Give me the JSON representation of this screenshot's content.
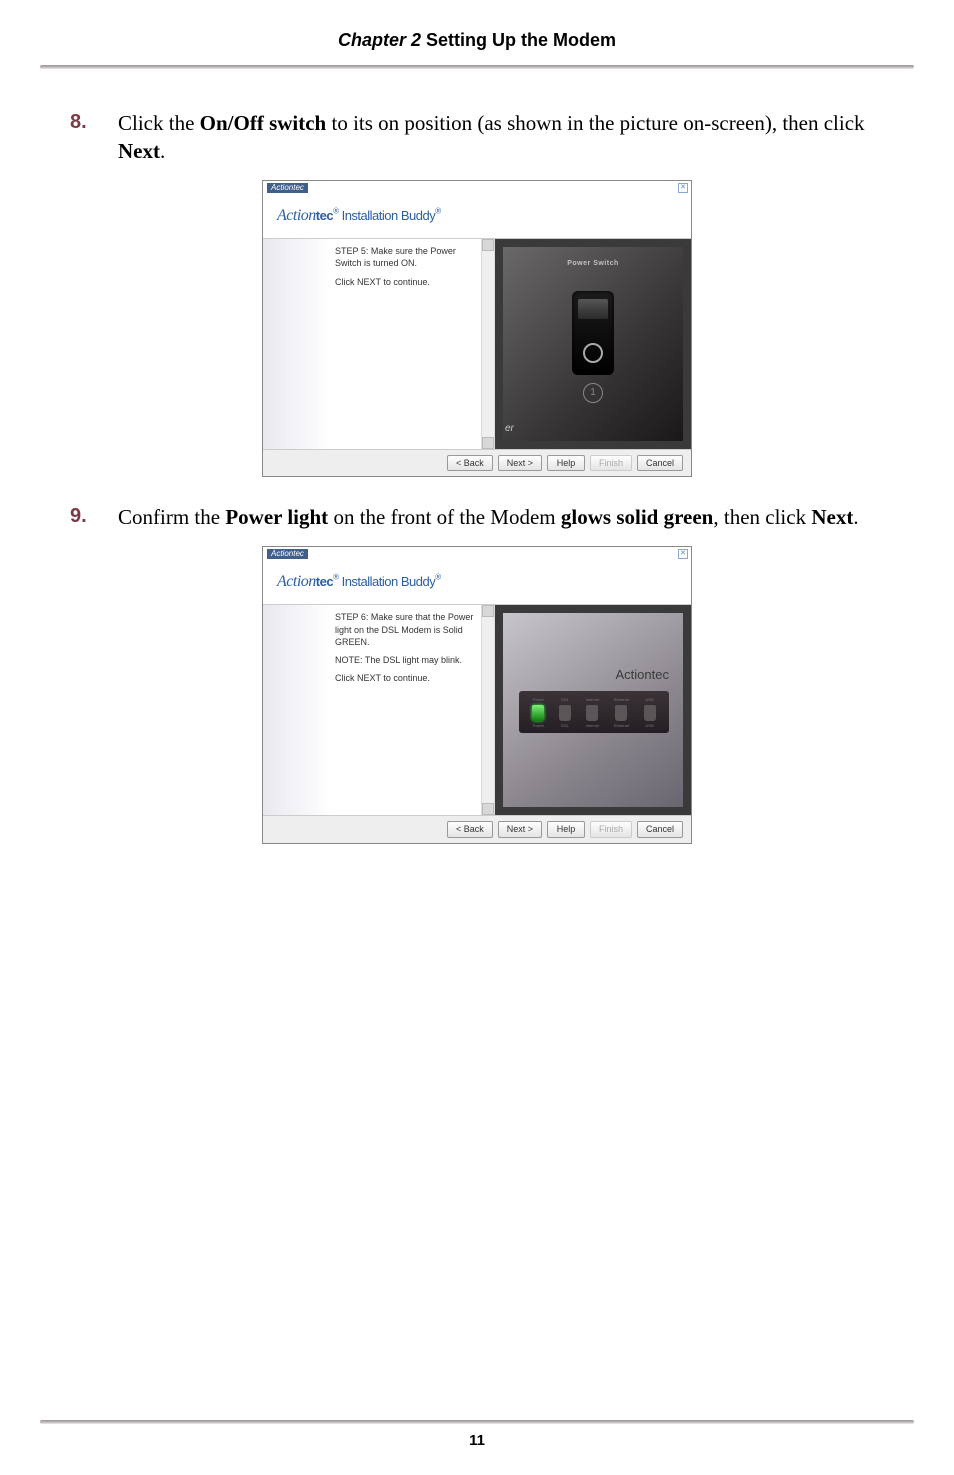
{
  "header": {
    "chapter_label": "Chapter 2",
    "chapter_title": "  Setting Up the Modem"
  },
  "steps": {
    "s8": {
      "num": "8.",
      "pre": "Click the ",
      "b1": "On/Off switch",
      "mid": " to its on position (as shown in the picture on-screen), then click ",
      "b2": "Next",
      "post": "."
    },
    "s9": {
      "num": "9.",
      "pre": "Confirm the ",
      "b1": "Power light",
      "mid": " on the front of the Modem ",
      "b2": "glows solid green",
      "post2": ", then click ",
      "b3": "Next",
      "post3": "."
    }
  },
  "wizard": {
    "title_badge": "Actiontec",
    "brand_html_prefix": "Action",
    "brand_html_suffix": "tec",
    "brand_reg": "®",
    "brand_product": " Installation Buddy",
    "brand_prod_reg": "®",
    "step5_l1": "STEP 5:  Make sure the Power Switch is turned ON.",
    "step5_l2": "Click NEXT to continue.",
    "power_switch_label": "Power Switch",
    "er_text": "er",
    "circle_one": "1",
    "step6_l1": "STEP 6:  Make sure that the Power light on the DSL Modem is Solid GREEN.",
    "step6_l2": "NOTE: The DSL light may blink.",
    "step6_l3": "Click NEXT to continue.",
    "led_labels": [
      "Power",
      "DSL",
      "Internet",
      "Ethernet",
      "USB"
    ],
    "led_labels_bottom": [
      "Power",
      "DSL",
      "Internet",
      "Ethernet",
      "USB"
    ],
    "buttons": {
      "back": "< Back",
      "next": "Next >",
      "help": "Help",
      "finish": "Finish",
      "cancel": "Cancel"
    }
  },
  "footer": {
    "page_num": "11"
  }
}
